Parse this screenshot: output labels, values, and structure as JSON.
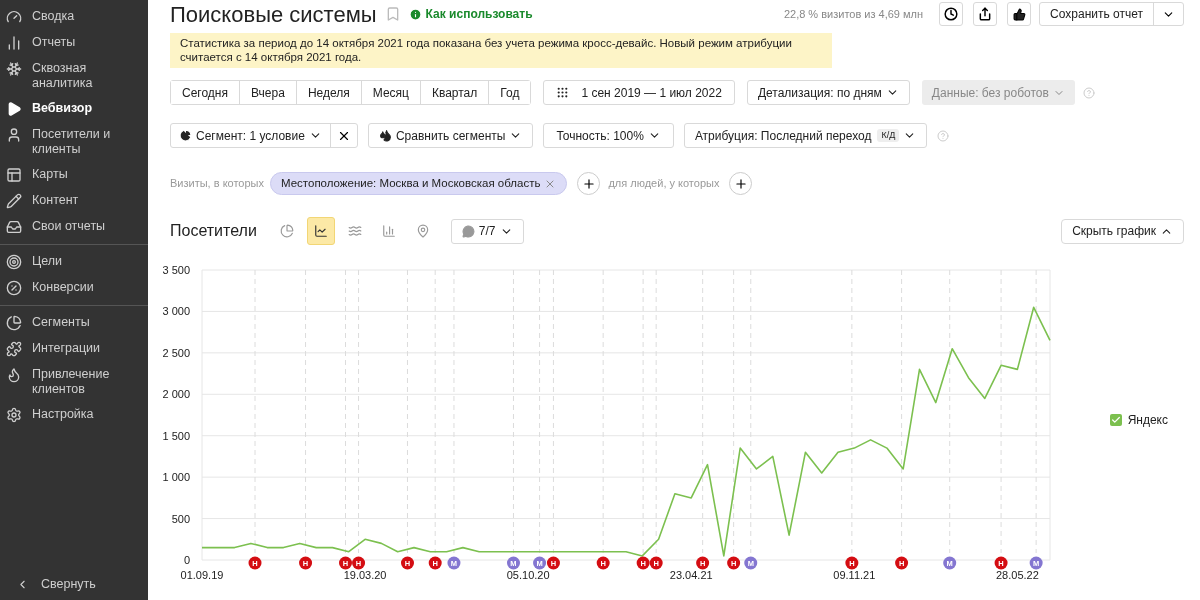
{
  "sidebar": {
    "groups": [
      [
        {
          "label": "Сводка",
          "selected": false
        },
        {
          "label": "Отчеты",
          "selected": false
        },
        {
          "label": "Сквозная аналитика",
          "selected": false
        },
        {
          "label": "Вебвизор",
          "selected": true
        },
        {
          "label": "Посетители и клиенты",
          "selected": false
        },
        {
          "label": "Карты",
          "selected": false
        },
        {
          "label": "Контент",
          "selected": false
        },
        {
          "label": "Свои отчеты",
          "selected": false
        }
      ],
      [
        {
          "label": "Цели",
          "selected": false
        },
        {
          "label": "Конверсии",
          "selected": false
        }
      ],
      [
        {
          "label": "Сегменты",
          "selected": false
        },
        {
          "label": "Интеграции",
          "selected": false
        },
        {
          "label": "Привлечение клиентов",
          "selected": false
        },
        {
          "label": "Настройка",
          "selected": false
        }
      ]
    ],
    "collapse": "Свернуть"
  },
  "header": {
    "title": "Поисковые системы",
    "help_link": "Как использовать",
    "sample": "22,8 % визитов из 4,69 млн",
    "save": "Сохранить отчет"
  },
  "notice": "Статистика за период до 14 октября 2021 года показана без учета режима кросс-девайс. Новый режим атрибуции считается с 14 октября 2021 года.",
  "periods": [
    {
      "label": "Сегодня",
      "selected": false
    },
    {
      "label": "Вчера",
      "selected": false
    },
    {
      "label": "Неделя",
      "selected": false
    },
    {
      "label": "Месяц",
      "selected": false
    },
    {
      "label": "Квартал",
      "selected": false
    },
    {
      "label": "Год",
      "selected": false
    }
  ],
  "date_range": "1 сен 2019 — 1 июл 2022",
  "detail": "Детализация: по дням",
  "data_filter": {
    "label": "Данные: без роботов",
    "disabled": true
  },
  "segment": "Сегмент: 1 условие",
  "compare": "Сравнить сегменты",
  "accuracy": "Точность: 100%",
  "attribution": {
    "label": "Атрибуция: Последний переход",
    "badge": "К/Д"
  },
  "filter": {
    "visits_label": "Визиты, в которых",
    "chip": "Местоположение: Москва и Московская область",
    "people_label": "для людей, у которых"
  },
  "chart": {
    "title": "Посетители",
    "chart_types": [
      {
        "selected": false
      },
      {
        "selected": true
      },
      {
        "selected": false
      },
      {
        "selected": false
      },
      {
        "selected": false
      }
    ],
    "notes": "7/7",
    "hide": "Скрыть график",
    "legend_checked": true,
    "markers": [
      {
        "text": "Н",
        "color": "#d40d12"
      },
      {
        "text": "Н",
        "color": "#d40d12"
      },
      {
        "text": "Н",
        "color": "#d40d12"
      },
      {
        "text": "Н",
        "color": "#d40d12"
      },
      {
        "text": "Н",
        "color": "#d40d12"
      },
      {
        "text": "Н",
        "color": "#d40d12"
      },
      {
        "text": "М",
        "color": "#8476d1"
      },
      {
        "text": "М",
        "color": "#8476d1"
      },
      {
        "text": "М",
        "color": "#8476d1"
      },
      {
        "text": "Н",
        "color": "#d40d12"
      },
      {
        "text": "Н",
        "color": "#d40d12"
      },
      {
        "text": "Н",
        "color": "#d40d12"
      },
      {
        "text": "Н",
        "color": "#d40d12"
      },
      {
        "text": "Н",
        "color": "#d40d12"
      },
      {
        "text": "Н",
        "color": "#d40d12"
      },
      {
        "text": "М",
        "color": "#8476d1"
      },
      {
        "text": "Н",
        "color": "#d40d12"
      },
      {
        "text": "Н",
        "color": "#d40d12"
      },
      {
        "text": "М",
        "color": "#8476d1"
      },
      {
        "text": "Н",
        "color": "#d40d12"
      },
      {
        "text": "М",
        "color": "#8476d1"
      }
    ],
    "chart_data": {
      "type": "line",
      "grid": true,
      "categories": [
        "01.09.19",
        null,
        null,
        null,
        null,
        null,
        null,
        null,
        null,
        null,
        "19.03.20",
        null,
        null,
        null,
        null,
        null,
        null,
        null,
        null,
        null,
        "05.10.20",
        null,
        null,
        null,
        null,
        null,
        null,
        null,
        null,
        null,
        "23.04.21",
        null,
        null,
        null,
        null,
        null,
        null,
        null,
        null,
        null,
        "09.11.21",
        null,
        null,
        null,
        null,
        null,
        null,
        null,
        null,
        null,
        "28.05.22",
        null,
        null
      ],
      "series": [
        {
          "name": "Яндекс",
          "color": "#7cc04f",
          "values": [
            150,
            150,
            150,
            200,
            150,
            150,
            200,
            150,
            150,
            100,
            250,
            200,
            100,
            150,
            100,
            100,
            150,
            100,
            100,
            100,
            100,
            100,
            100,
            100,
            100,
            100,
            100,
            50,
            250,
            800,
            750,
            1150,
            50,
            1350,
            1100,
            1250,
            300,
            1300,
            1050,
            1300,
            1350,
            1450,
            1350,
            1100,
            2300,
            1900,
            2550,
            2200,
            1950,
            2350,
            2300,
            3050,
            2650
          ]
        }
      ],
      "ylim": [
        0,
        3500
      ],
      "yticks": [
        0,
        500,
        1000,
        1500,
        2000,
        2500,
        3000,
        3500
      ]
    }
  }
}
